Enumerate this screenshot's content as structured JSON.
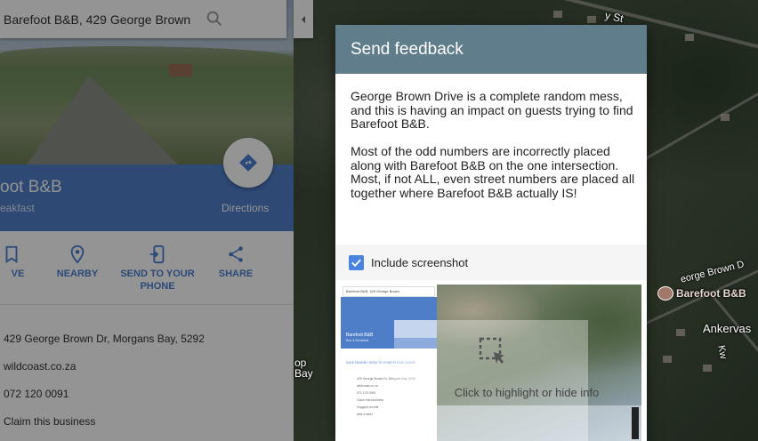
{
  "search": {
    "value": "Barefoot B&B, 429 George Brown"
  },
  "place": {
    "name": "oot B&B",
    "type": "eakfast",
    "directions_label": "Directions"
  },
  "actions": [
    {
      "label": "VE",
      "icon": "bookmark-icon"
    },
    {
      "label": "NEARBY",
      "icon": "nearby-icon"
    },
    {
      "label": "SEND TO YOUR PHONE",
      "icon": "send-to-phone-icon"
    },
    {
      "label": "SHARE",
      "icon": "share-icon"
    }
  ],
  "info": {
    "address": "429 George Brown Dr, Morgans Bay, 5292",
    "website": "wildcoast.co.za",
    "phone": "072 120 0091",
    "claim": "Claim this business"
  },
  "map_labels": {
    "street": "y St",
    "place": "Barefoot B&B",
    "road": "eorge Brown D",
    "ankervas": "Ankervas",
    "op_bay": "op\nBay",
    "kw": "Kw"
  },
  "feedback": {
    "title": "Send feedback",
    "text": "George Brown Drive is a complete random mess, and this is having an impact on guests trying to find Barefoot B&B.\n\nMost of the odd numbers are incorrectly placed along with Barefoot B&B on the one intersection. Most, if not ALL, even street numbers are placed all together where Barefoot B&B actually IS!",
    "include_label": "Include screenshot",
    "include_checked": true,
    "highlight_label": "Click to highlight or hide info"
  },
  "preview": {
    "search": "Barefoot B&B, 429 George Brown",
    "name": "Barefoot B&B",
    "type": "Bed & Breakfast",
    "actions": "SAVE   NEARBY   SEND TO YOUR PHONE   SHARE",
    "lines": "429 George Brown Dr, Morgans Bay, 5292\nwildcoast.co.za\n072 120 0091\nClaim this business\nSuggest an edit\nAdd a label"
  },
  "colors": {
    "accent_blue": "#4f7ec9",
    "dialog_header": "#607d8b",
    "checkbox": "#4a84e0"
  }
}
